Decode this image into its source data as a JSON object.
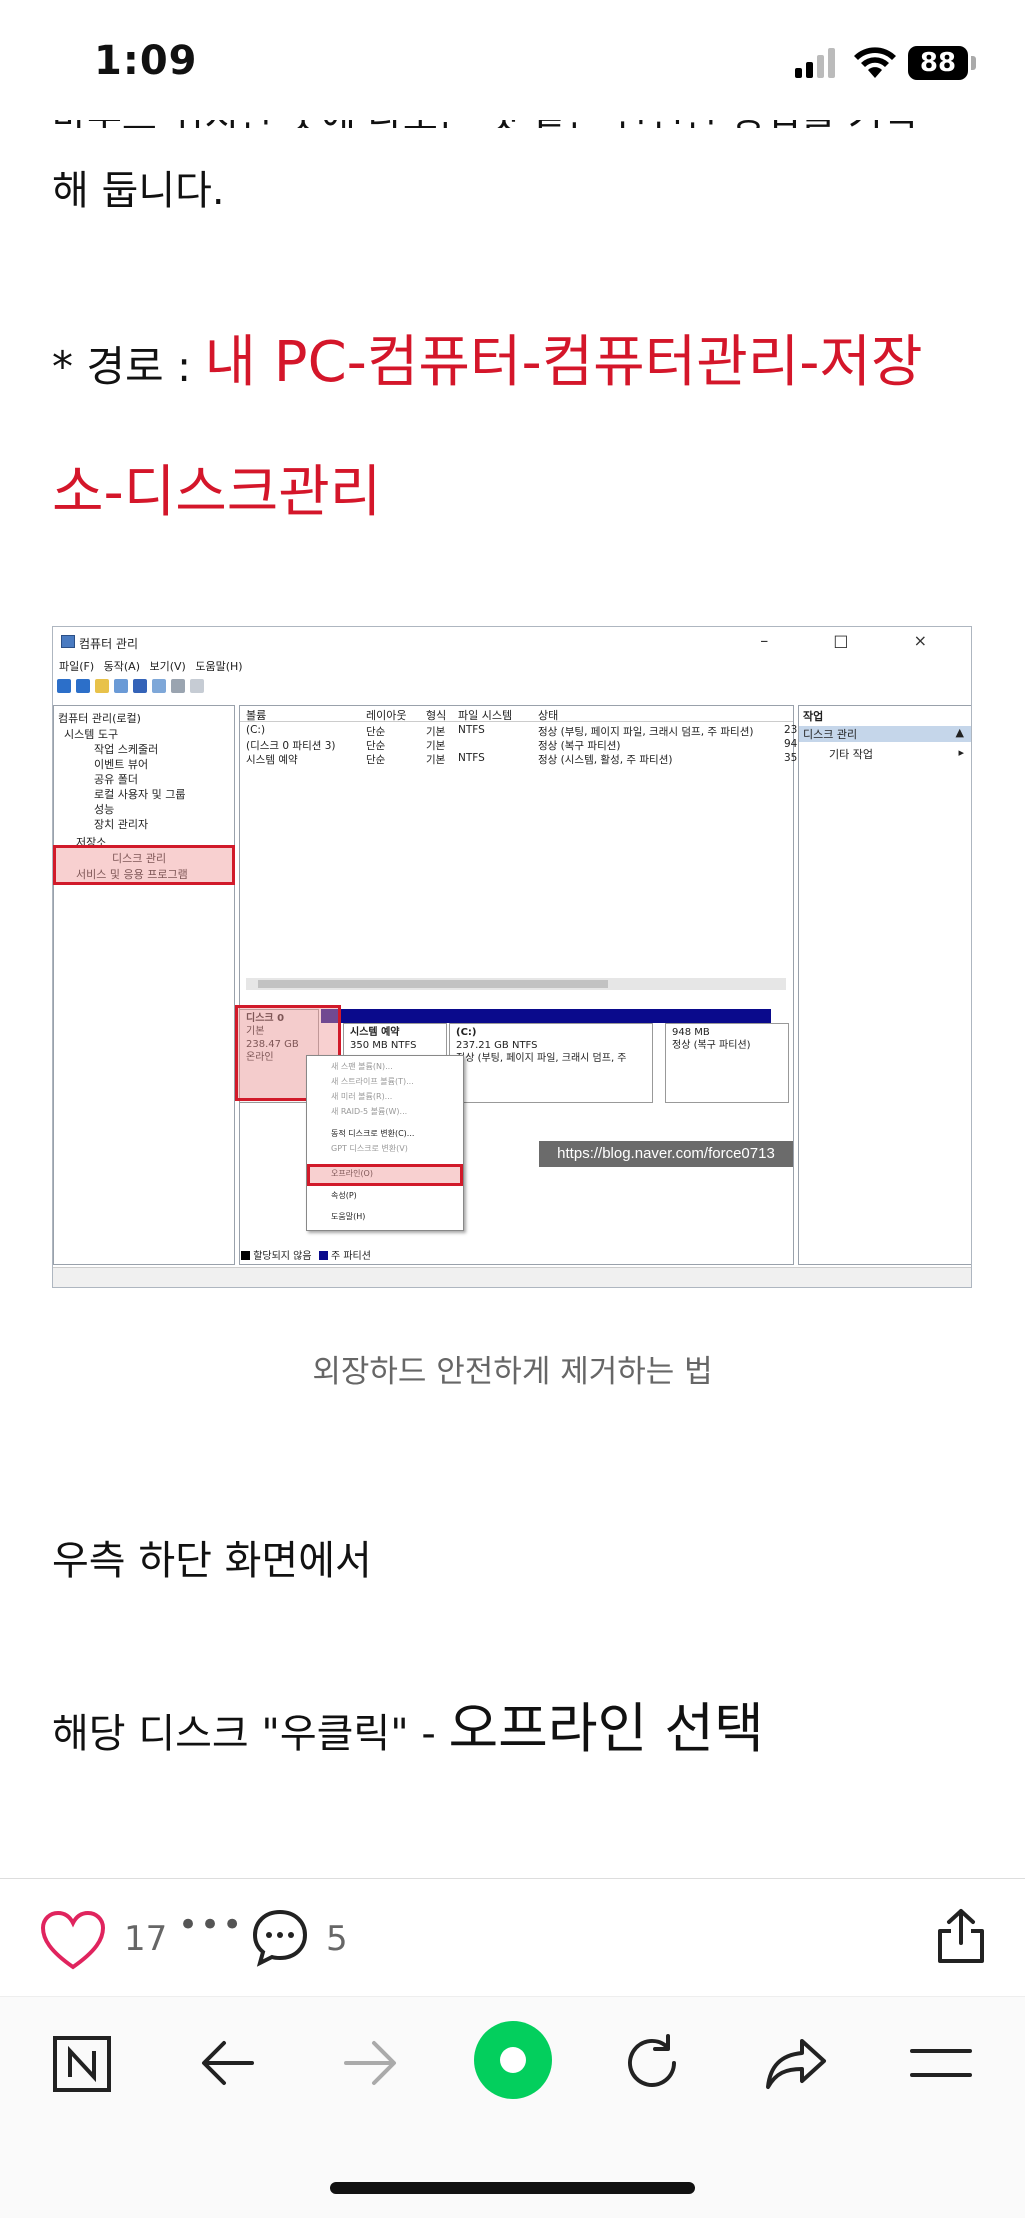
{
  "status_bar": {
    "time": "1:09",
    "battery": "88"
  },
  "article": {
    "cut_line": "마우스 위치한 곳에 나오는 것 같은 안전한 방법을 기억",
    "para1": "해 둡니다.",
    "path_label": "* 경로 : ",
    "path_value": "내 PC-컴퓨터-컴퓨터관리-저장소-디스크관리",
    "caption": "외장하드 안전하게 제거하는 법",
    "para2": "우측 하단 화면에서",
    "para3_prefix": "해당 디스크 \"우클릭\" - ",
    "para3_emph": "오프라인 선택"
  },
  "screenshot": {
    "window_title": "컴퓨터 관리",
    "win_buttons": "–  □  ×",
    "menu": "파일(F) 동작(A) 보기(V) 도움말(H)",
    "tree": [
      "컴퓨터 관리(로컬)",
      "시스템 도구",
      "작업 스케줄러",
      "이벤트 뷰어",
      "공유 폴더",
      "로컬 사용자 및 그룹",
      "성능",
      "장치 관리자",
      "저장소",
      "디스크 관리",
      "서비스 및 응용 프로그램"
    ],
    "columns": [
      "볼륨",
      "레이아웃",
      "형식",
      "파일 시스템",
      "상태"
    ],
    "volumes": [
      {
        "name": "(C:)",
        "layout": "단순",
        "type": "기본",
        "fs": "NTFS",
        "status": "정상 (부팅, 페이지 파일, 크래시 덤프, 주 파티션)",
        "extra": "23"
      },
      {
        "name": "(디스크 0 파티션 3)",
        "layout": "단순",
        "type": "기본",
        "fs": "",
        "status": "정상 (복구 파티션)",
        "extra": "94"
      },
      {
        "name": "시스템 예약",
        "layout": "단순",
        "type": "기본",
        "fs": "NTFS",
        "status": "정상 (시스템, 활성, 주 파티션)",
        "extra": "35"
      }
    ],
    "actions_title": "작업",
    "actions_item": "디스크 관리",
    "actions_sub": "기타 작업",
    "disk": {
      "name": "디스크 0",
      "kind": "기본",
      "size": "238.47 GB",
      "state": "온라인"
    },
    "partitions": [
      {
        "title": "시스템 예약",
        "line1": "350 MB NTFS",
        "line2": ""
      },
      {
        "title": "(C:)",
        "line1": "237.21 GB NTFS",
        "line2": "정상 (부팅, 페이지 파일, 크래시 덤프, 주"
      },
      {
        "title": "",
        "line1": "948 MB",
        "line2": "정상 (복구 파티션)"
      }
    ],
    "context_menu": [
      "새 스팬 볼륨(N)...",
      "새 스트라이프 볼륨(T)...",
      "새 미러 볼륨(R)...",
      "새 RAID-5 볼륨(W)...",
      "동적 디스크로 변환(C)...",
      "GPT 디스크로 변환(V)",
      "오프라인(O)",
      "속성(P)",
      "도움말(H)"
    ],
    "watermark": "https://blog.naver.com/force0713",
    "legend_unalloc": "할당되지 않음",
    "legend_primary": "주 파티션"
  },
  "reactions": {
    "likes": "17",
    "more": "•••",
    "comments": "5"
  },
  "colors": {
    "accent_red": "#d4162a",
    "like_pink": "#e0245e",
    "naver_green": "#03cf5d"
  },
  "icons": [
    "heart-icon",
    "comment-icon",
    "share-icon",
    "naver-n-icon",
    "back-arrow-icon",
    "forward-arrow-icon",
    "green-dot-icon",
    "reload-icon",
    "share-arrow-icon",
    "menu-icon"
  ]
}
